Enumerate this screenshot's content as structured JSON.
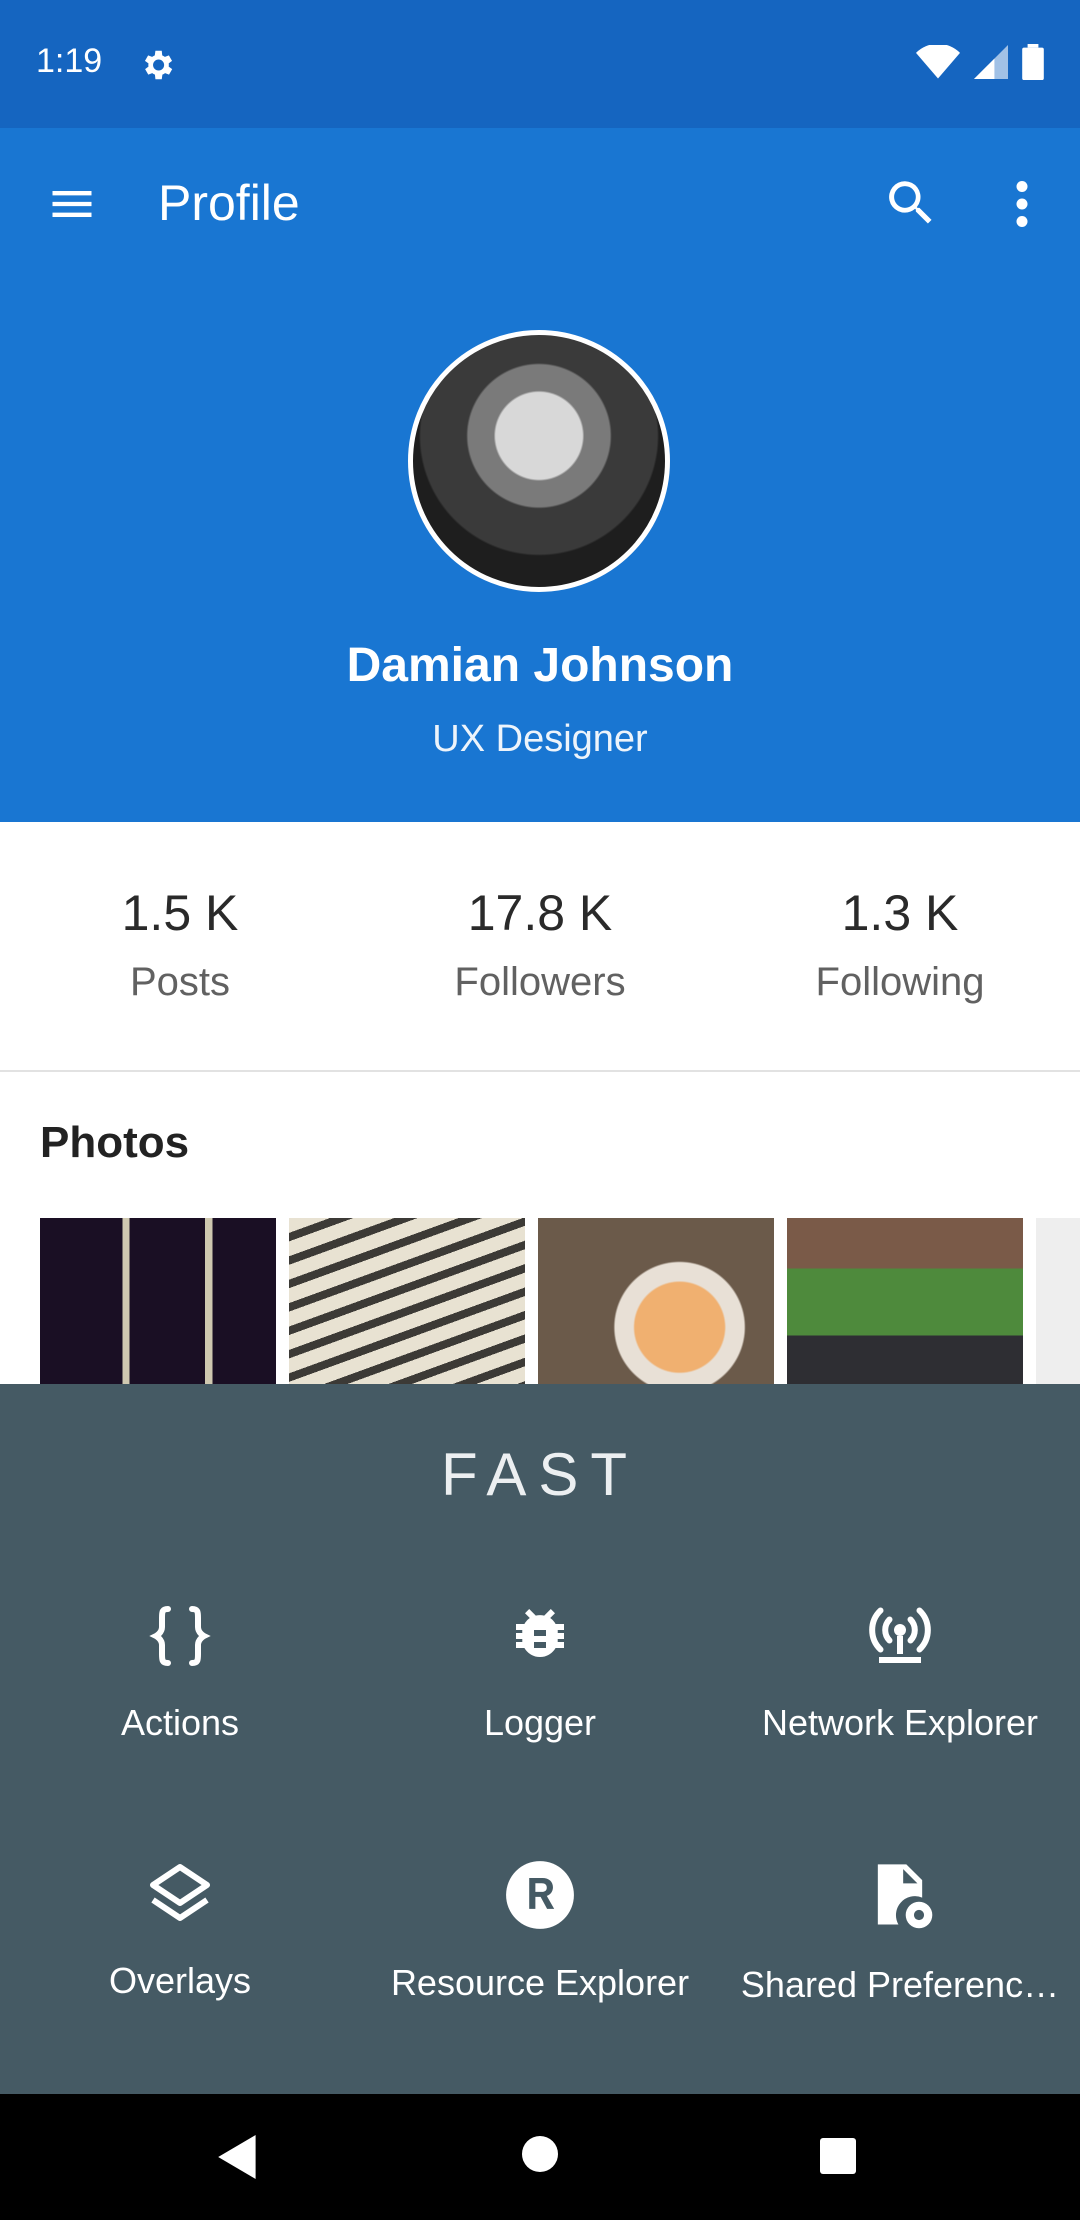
{
  "status_bar": {
    "time": "1:19"
  },
  "app_bar": {
    "title": "Profile"
  },
  "profile": {
    "name": "Damian Johnson",
    "role": "UX Designer"
  },
  "stats": [
    {
      "value": "1.5 K",
      "label": "Posts"
    },
    {
      "value": "17.8 K",
      "label": "Followers"
    },
    {
      "value": "1.3 K",
      "label": "Following"
    }
  ],
  "photos": {
    "title": "Photos"
  },
  "fast_panel": {
    "title": "FAST",
    "tools": [
      {
        "label": "Actions",
        "icon": "braces-icon"
      },
      {
        "label": "Logger",
        "icon": "bug-icon"
      },
      {
        "label": "Network Explorer",
        "icon": "network-antenna-icon"
      },
      {
        "label": "Overlays",
        "icon": "layers-icon"
      },
      {
        "label": "Resource Explorer",
        "icon": "resource-r-icon"
      },
      {
        "label": "Shared Preferenc…",
        "icon": "settings-file-icon"
      }
    ]
  },
  "colors": {
    "primary": "#1976d2",
    "status_bar": "#1565c0",
    "panel": "#455a64"
  }
}
